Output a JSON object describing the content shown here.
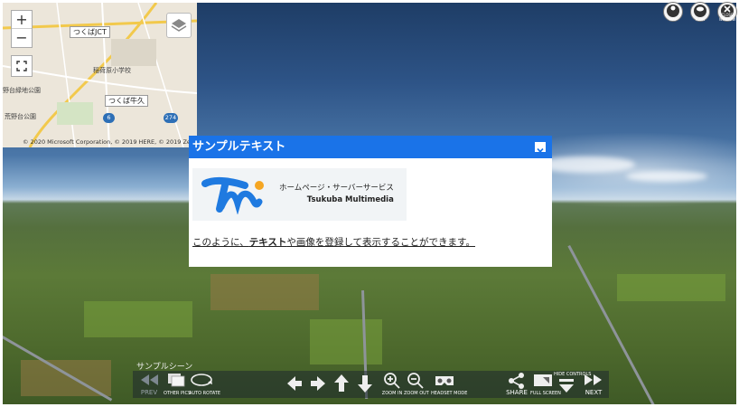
{
  "map": {
    "labels": {
      "tsukuba_jct": "つくばJCT",
      "inari_elem": "稲荷原小学校",
      "tsukuba_ushiku": "つくば牛久",
      "park1": "野台緑地公園",
      "park2": "荒野台公園"
    },
    "route_badges": {
      "r6": "6",
      "r274": "274"
    },
    "copyright": "© 2020 Microsoft Corporation, © 2019 HERE, © 2019 Zenrin",
    "zoom_in": "+",
    "zoom_out": "−"
  },
  "top_icons": {
    "map": "MAP",
    "icon": "ICON",
    "close": "CLOSE WINDOW"
  },
  "popup": {
    "title": "サンプルテキスト",
    "logo_line1": "ホームページ・サーバーサービス",
    "logo_line2": "Tsukuba Multimedia",
    "msg_pre": "このように、",
    "msg_bold": "テキスト",
    "msg_post": "や画像を登録して表示することができます。"
  },
  "scene_name": "サンプルシーン",
  "toolbar": {
    "prev": "PREV",
    "other_pics": "OTHER PICS",
    "auto_rotate": "AUTO ROTATE",
    "zoom_in": "ZOOM IN",
    "zoom_out": "ZOOM OUT",
    "headset": "HEADSET MODE",
    "share": "SHARE",
    "full_screen": "FULL SCREEN",
    "hide_controls": "HIDE CONTROLS",
    "next": "NEXT"
  },
  "colors": {
    "popup_header": "#1a73e8",
    "logo_blue": "#1f7ae0",
    "logo_orange": "#f5a623"
  }
}
